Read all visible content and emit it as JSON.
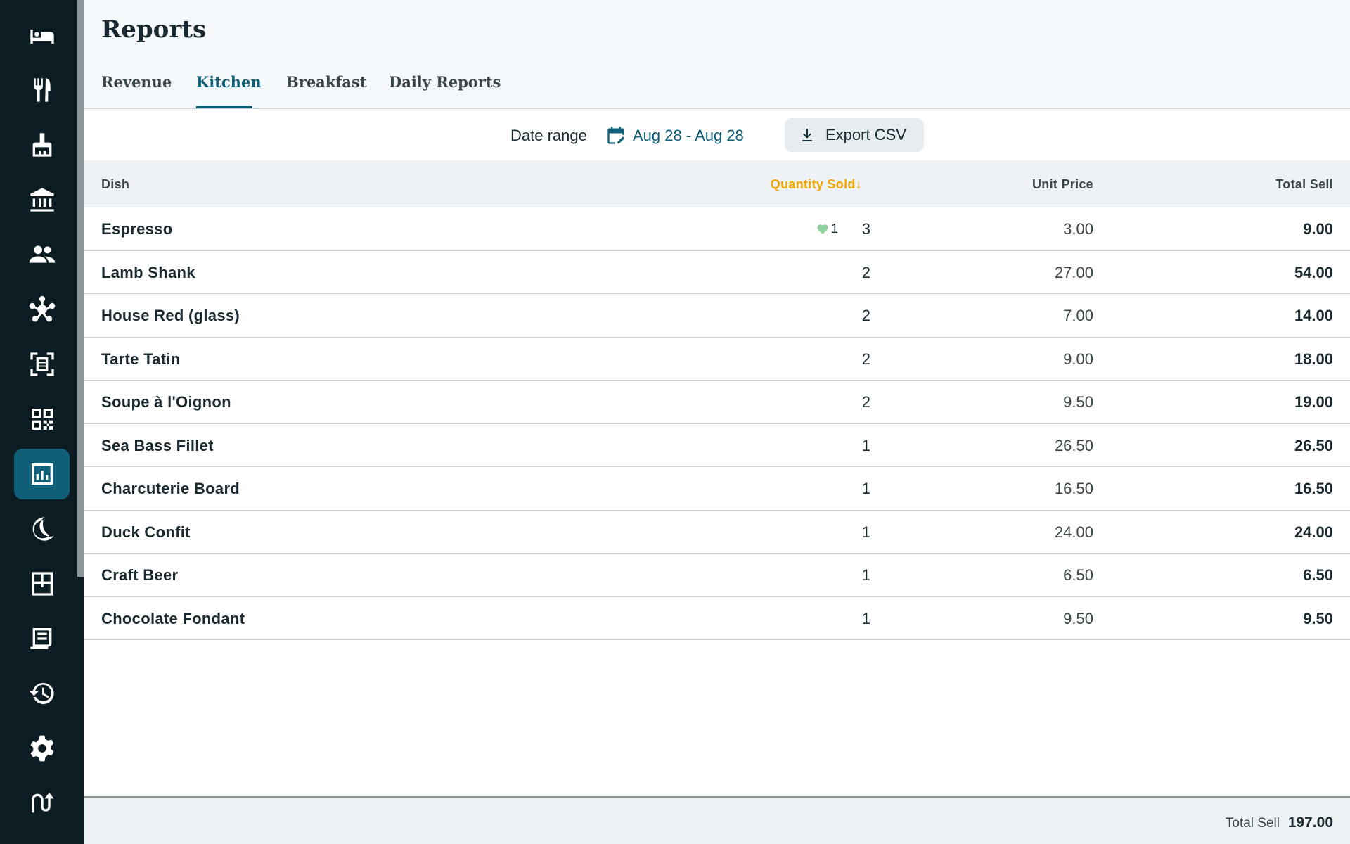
{
  "sidebar": {
    "items": [
      {
        "icon": "bed-icon",
        "active": false
      },
      {
        "icon": "fork-knife-icon",
        "active": false
      },
      {
        "icon": "cleaning-brush-icon",
        "active": false
      },
      {
        "icon": "bank-building-icon",
        "active": false
      },
      {
        "icon": "guests-icon",
        "active": false
      },
      {
        "icon": "network-hub-icon",
        "active": false
      },
      {
        "icon": "receipt-scan-icon",
        "active": false
      },
      {
        "icon": "qr-code-icon",
        "active": false
      },
      {
        "icon": "reports-chart-icon",
        "active": true
      },
      {
        "icon": "moon-icon",
        "active": false
      },
      {
        "icon": "rooms-grid-icon",
        "active": false
      },
      {
        "icon": "invoice-icon",
        "active": false
      },
      {
        "icon": "history-icon",
        "active": false
      },
      {
        "icon": "settings-gear-icon",
        "active": false
      },
      {
        "icon": "logout-arrows-icon",
        "active": false
      }
    ]
  },
  "header": {
    "title": "Reports",
    "tabs": [
      {
        "label": "Revenue",
        "active": false
      },
      {
        "label": "Kitchen",
        "active": true
      },
      {
        "label": "Breakfast",
        "active": false
      },
      {
        "label": "Daily Reports",
        "active": false
      }
    ]
  },
  "toolbar": {
    "date_label": "Date range",
    "date_value": "Aug 28 - Aug 28",
    "export_label": "Export CSV"
  },
  "table": {
    "columns": {
      "dish": "Dish",
      "quantity": "Quantity Sold",
      "sort_indicator": "↓",
      "unit_price": "Unit Price",
      "total": "Total Sell"
    },
    "rows": [
      {
        "dish": "Espresso",
        "fav_count": "1",
        "quantity": "3",
        "unit_price": "3.00",
        "total": "9.00"
      },
      {
        "dish": "Lamb Shank",
        "quantity": "2",
        "unit_price": "27.00",
        "total": "54.00"
      },
      {
        "dish": "House Red (glass)",
        "quantity": "2",
        "unit_price": "7.00",
        "total": "14.00"
      },
      {
        "dish": "Tarte Tatin",
        "quantity": "2",
        "unit_price": "9.00",
        "total": "18.00"
      },
      {
        "dish": "Soupe à l'Oignon",
        "quantity": "2",
        "unit_price": "9.50",
        "total": "19.00"
      },
      {
        "dish": "Sea Bass Fillet",
        "quantity": "1",
        "unit_price": "26.50",
        "total": "26.50"
      },
      {
        "dish": "Charcuterie Board",
        "quantity": "1",
        "unit_price": "16.50",
        "total": "16.50"
      },
      {
        "dish": "Duck Confit",
        "quantity": "1",
        "unit_price": "24.00",
        "total": "24.00"
      },
      {
        "dish": "Craft Beer",
        "quantity": "1",
        "unit_price": "6.50",
        "total": "6.50"
      },
      {
        "dish": "Chocolate Fondant",
        "quantity": "1",
        "unit_price": "9.50",
        "total": "9.50"
      }
    ]
  },
  "footer": {
    "total_label": "Total Sell",
    "total_value": "197.00"
  },
  "colors": {
    "sidebar_bg": "#0b1d22",
    "accent": "#0f5f78",
    "sort_highlight": "#f0a500",
    "favorite": "#8fd19e"
  }
}
